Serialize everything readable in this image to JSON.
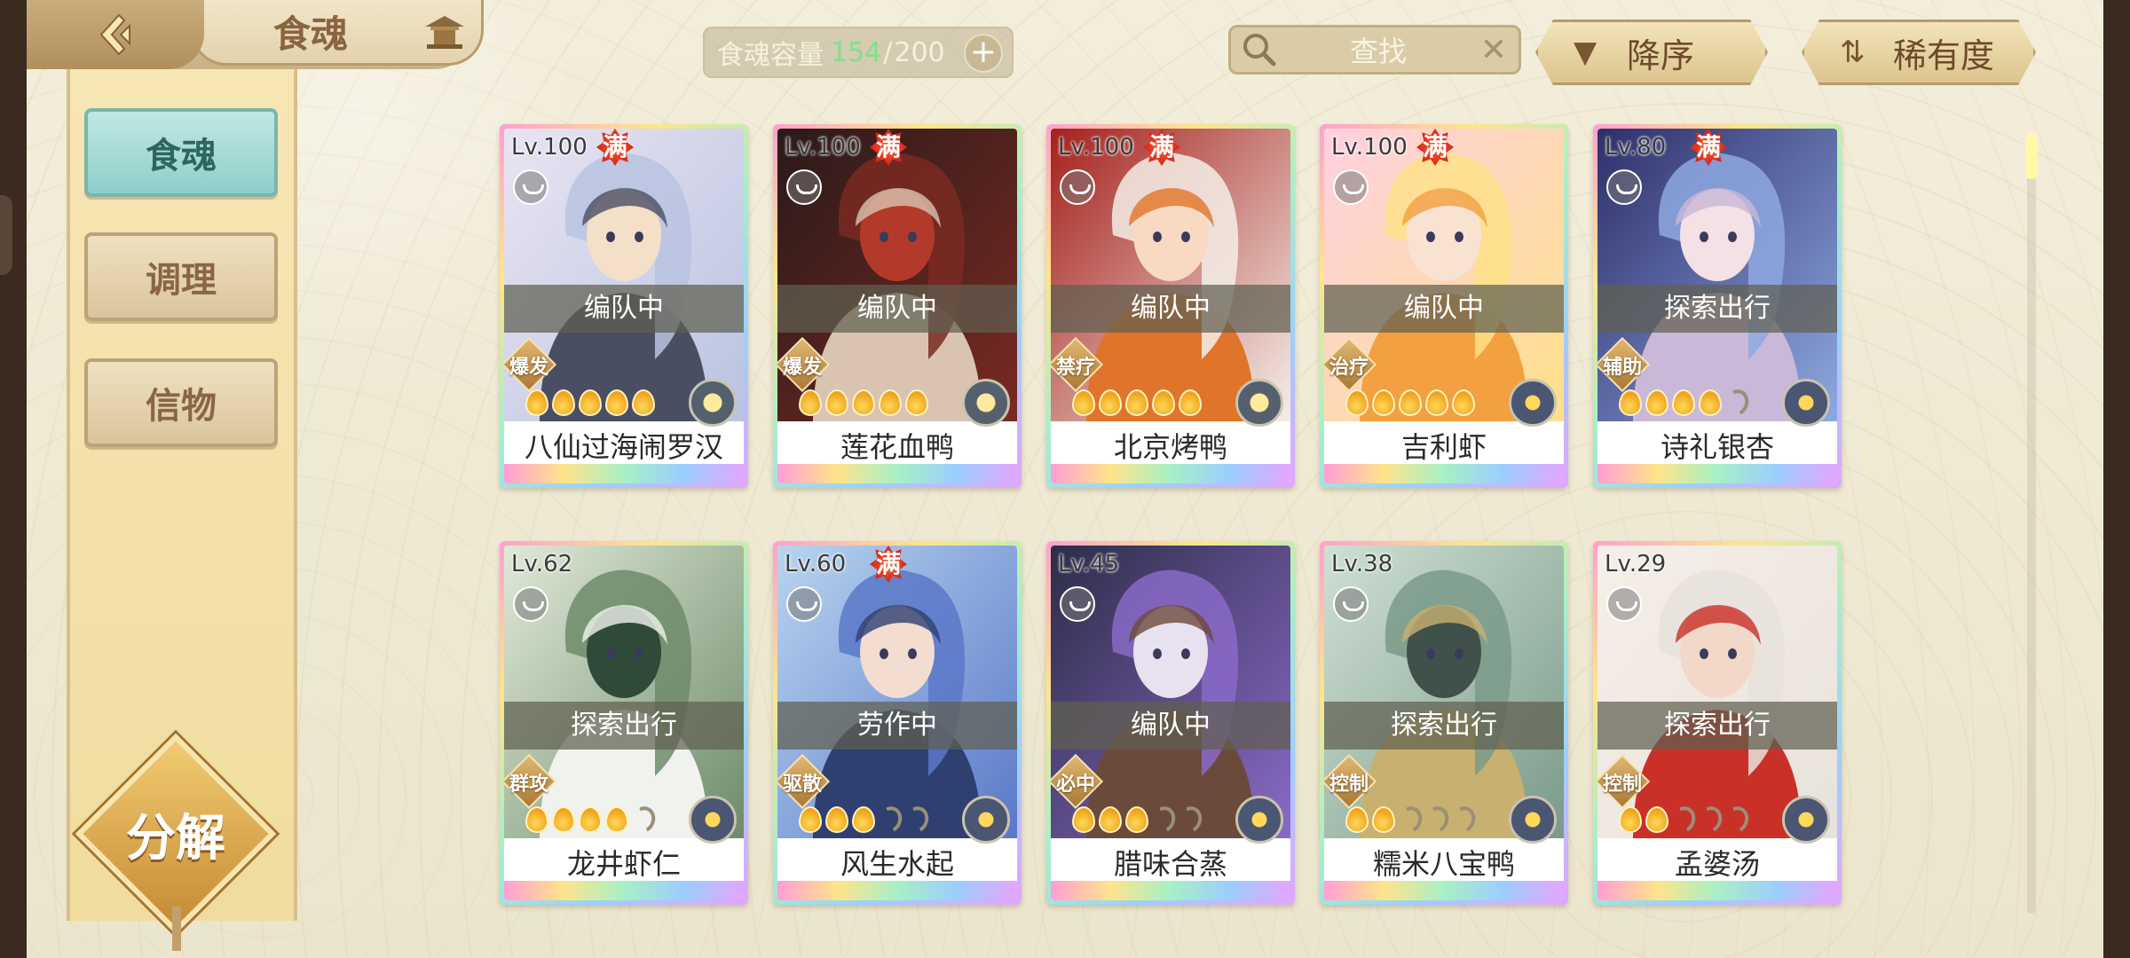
{
  "header": {
    "title": "食魂",
    "capacity_label": "食魂容量",
    "capacity_current": "154",
    "capacity_separator": "/",
    "capacity_max": "200",
    "search_placeholder": "查找",
    "sort_order_label": "降序",
    "sort_field_label": "稀有度"
  },
  "sidebar": {
    "tabs": [
      "食魂",
      "调理",
      "信物"
    ],
    "active_tab": "食魂",
    "decompose_label": "分解"
  },
  "colors": {
    "accent_teal": "#8ecfc9",
    "capacity_current": "#7fe08c",
    "full_badge": "#d3261b"
  },
  "cards": [
    {
      "level": "Lv.100",
      "full": "满",
      "status": "编队中",
      "role": "爆发",
      "stars": 5,
      "max_stars": 5,
      "name": "八仙过海闹罗汉",
      "element": "gold"
    },
    {
      "level": "Lv.100",
      "full": "满",
      "status": "编队中",
      "role": "爆发",
      "stars": 5,
      "max_stars": 5,
      "name": "莲花血鸭",
      "element": "gold"
    },
    {
      "level": "Lv.100",
      "full": "满",
      "status": "编队中",
      "role": "禁疗",
      "stars": 5,
      "max_stars": 5,
      "name": "北京烤鸭",
      "element": "gold"
    },
    {
      "level": "Lv.100",
      "full": "满",
      "status": "编队中",
      "role": "治疗",
      "stars": 5,
      "max_stars": 5,
      "name": "吉利虾",
      "element": "blue"
    },
    {
      "level": "Lv.80",
      "full": "满",
      "status": "探索出行",
      "role": "辅助",
      "stars": 4,
      "max_stars": 5,
      "name": "诗礼银杏",
      "element": "blue"
    },
    {
      "level": "Lv.62",
      "full": "",
      "status": "探索出行",
      "role": "群攻",
      "stars": 4,
      "max_stars": 5,
      "name": "龙井虾仁",
      "element": "blue"
    },
    {
      "level": "Lv.60",
      "full": "满",
      "status": "劳作中",
      "role": "驱散",
      "stars": 3,
      "max_stars": 5,
      "name": "风生水起",
      "element": "blue"
    },
    {
      "level": "Lv.45",
      "full": "",
      "status": "编队中",
      "role": "必中",
      "stars": 3,
      "max_stars": 5,
      "name": "腊味合蒸",
      "element": "blue"
    },
    {
      "level": "Lv.38",
      "full": "",
      "status": "探索出行",
      "role": "控制",
      "stars": 2,
      "max_stars": 5,
      "name": "糯米八宝鸭",
      "element": "blue"
    },
    {
      "level": "Lv.29",
      "full": "",
      "status": "探索出行",
      "role": "控制",
      "stars": 2,
      "max_stars": 5,
      "name": "孟婆汤",
      "element": "blue"
    }
  ]
}
